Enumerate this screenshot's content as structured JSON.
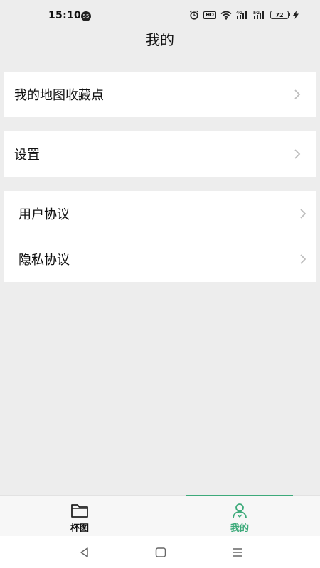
{
  "status_bar": {
    "time": "15:10",
    "notification_count": "55",
    "battery_level": "72",
    "icons": [
      "alarm-icon",
      "hd-icon",
      "wifi-icon",
      "signal-4g-icon",
      "signal-5g-icon",
      "battery-icon",
      "charging-icon"
    ],
    "hd_label": "HD",
    "net1": "4G",
    "net2": "5G"
  },
  "header": {
    "title": "我的"
  },
  "sections": [
    {
      "items": [
        {
          "label": "我的地图收藏点",
          "icon": "chevron-right-icon"
        }
      ]
    },
    {
      "items": [
        {
          "label": "设置",
          "icon": "chevron-right-icon"
        }
      ]
    },
    {
      "items": [
        {
          "label": "用户协议",
          "icon": "chevron-right-icon"
        },
        {
          "label": "隐私协议",
          "icon": "chevron-right-icon"
        }
      ]
    }
  ],
  "tab_bar": {
    "tabs": [
      {
        "label": "杯图",
        "icon": "folder-icon",
        "active": false
      },
      {
        "label": "我的",
        "icon": "user-icon",
        "active": true
      }
    ],
    "active_color": "#3daa7a"
  },
  "system_nav": {
    "icons": [
      "back-icon",
      "home-icon",
      "menu-icon"
    ]
  },
  "colors": {
    "background": "#ededed",
    "card": "#ffffff",
    "accent": "#3daa7a"
  }
}
